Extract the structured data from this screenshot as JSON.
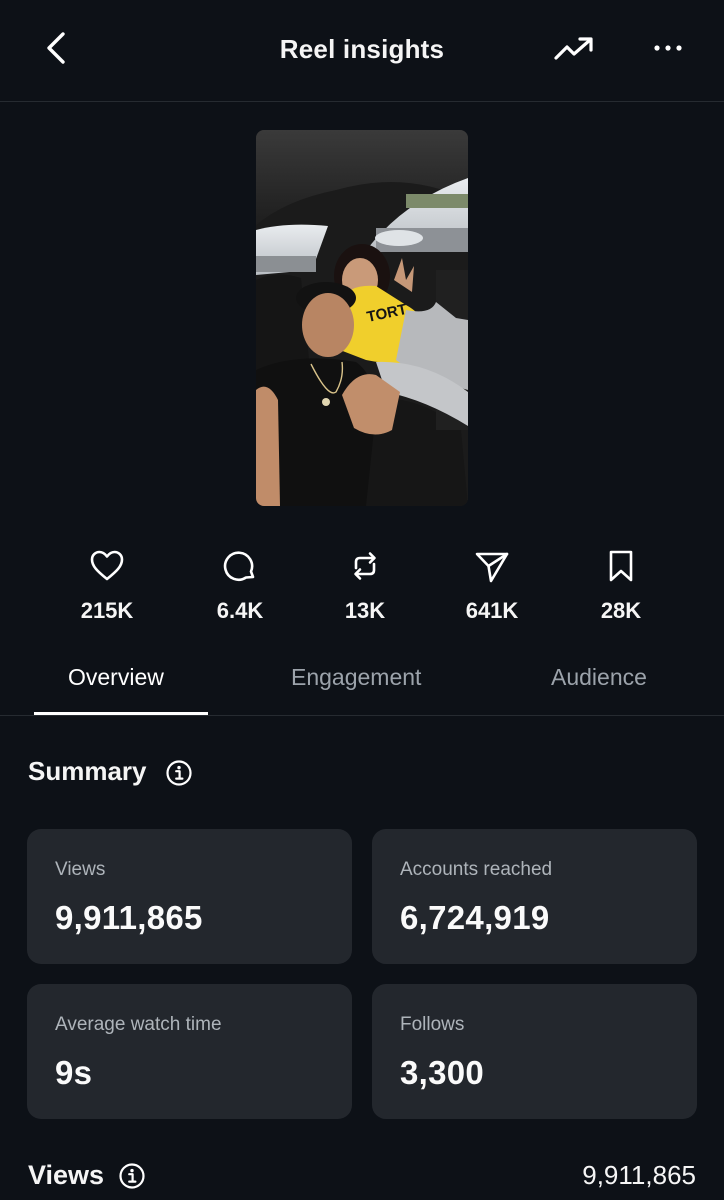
{
  "header": {
    "title": "Reel insights",
    "icons": [
      "chevron-left-icon",
      "trending-up-icon",
      "more-horizontal-icon"
    ]
  },
  "reel": {
    "shirt_text": "TORT"
  },
  "stats": [
    {
      "icon": "heart-icon",
      "label": "likes",
      "value": "215K"
    },
    {
      "icon": "comment-icon",
      "label": "comments",
      "value": "6.4K"
    },
    {
      "icon": "repost-icon",
      "label": "reposts",
      "value": "13K"
    },
    {
      "icon": "share-icon",
      "label": "shares",
      "value": "641K"
    },
    {
      "icon": "bookmark-icon",
      "label": "saves",
      "value": "28K"
    }
  ],
  "tabs": [
    {
      "label": "Overview",
      "active": true
    },
    {
      "label": "Engagement",
      "active": false
    },
    {
      "label": "Audience",
      "active": false
    }
  ],
  "summary": {
    "title": "Summary",
    "cards": [
      {
        "label": "Views",
        "value": "9,911,865"
      },
      {
        "label": "Accounts reached",
        "value": "6,724,919"
      },
      {
        "label": "Average watch time",
        "value": "9s"
      },
      {
        "label": "Follows",
        "value": "3,300"
      }
    ]
  },
  "views_section": {
    "title": "Views",
    "total": "9,911,865"
  },
  "colors": {
    "background": "#0d1117",
    "card": "#23272d",
    "muted_text": "#9ca3ab",
    "active_tab_underline": "#ffffff"
  }
}
